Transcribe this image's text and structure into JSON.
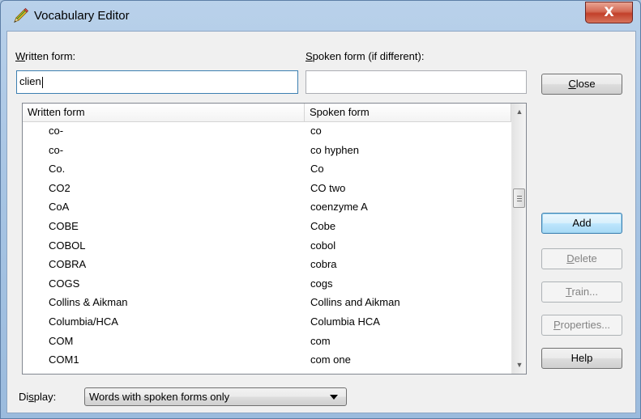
{
  "window": {
    "title": "Vocabulary Editor",
    "close_glyph": "X"
  },
  "labels": {
    "written_form_accel": "W",
    "written_form_rest": "ritten form:",
    "spoken_form_accel": "S",
    "spoken_form_rest": "poken form (if different):",
    "display_pre": "Di",
    "display_accel": "s",
    "display_post": "play:"
  },
  "inputs": {
    "written_form_value": "clien",
    "spoken_form_value": ""
  },
  "buttons": {
    "close": {
      "accel": "C",
      "rest": "lose"
    },
    "add": "Add",
    "delete": {
      "accel": "D",
      "rest": "elete"
    },
    "train": {
      "accel": "T",
      "rest": "rain..."
    },
    "properties": {
      "accel": "P",
      "rest": "roperties..."
    },
    "help": "Help"
  },
  "list": {
    "columns": [
      "Written form",
      "Spoken form"
    ],
    "rows": [
      {
        "written": "co-",
        "spoken": "co"
      },
      {
        "written": "co-",
        "spoken": "co hyphen"
      },
      {
        "written": "Co.",
        "spoken": "Co"
      },
      {
        "written": "CO2",
        "spoken": "CO two"
      },
      {
        "written": "CoA",
        "spoken": "coenzyme A"
      },
      {
        "written": "COBE",
        "spoken": "Cobe"
      },
      {
        "written": "COBOL",
        "spoken": "cobol"
      },
      {
        "written": "COBRA",
        "spoken": "cobra"
      },
      {
        "written": "COGS",
        "spoken": "cogs"
      },
      {
        "written": "Collins & Aikman",
        "spoken": "Collins and Aikman"
      },
      {
        "written": "Columbia/HCA",
        "spoken": "Columbia HCA"
      },
      {
        "written": "COM",
        "spoken": "com"
      },
      {
        "written": "COM1",
        "spoken": "com one"
      }
    ]
  },
  "display_select": {
    "value": "Words with spoken forms only"
  },
  "icons": {
    "title": "pencil-icon",
    "scroll_up": "scroll-up-arrow-icon",
    "scroll_down": "scroll-down-arrow-icon",
    "combo": "chevron-down-icon"
  }
}
